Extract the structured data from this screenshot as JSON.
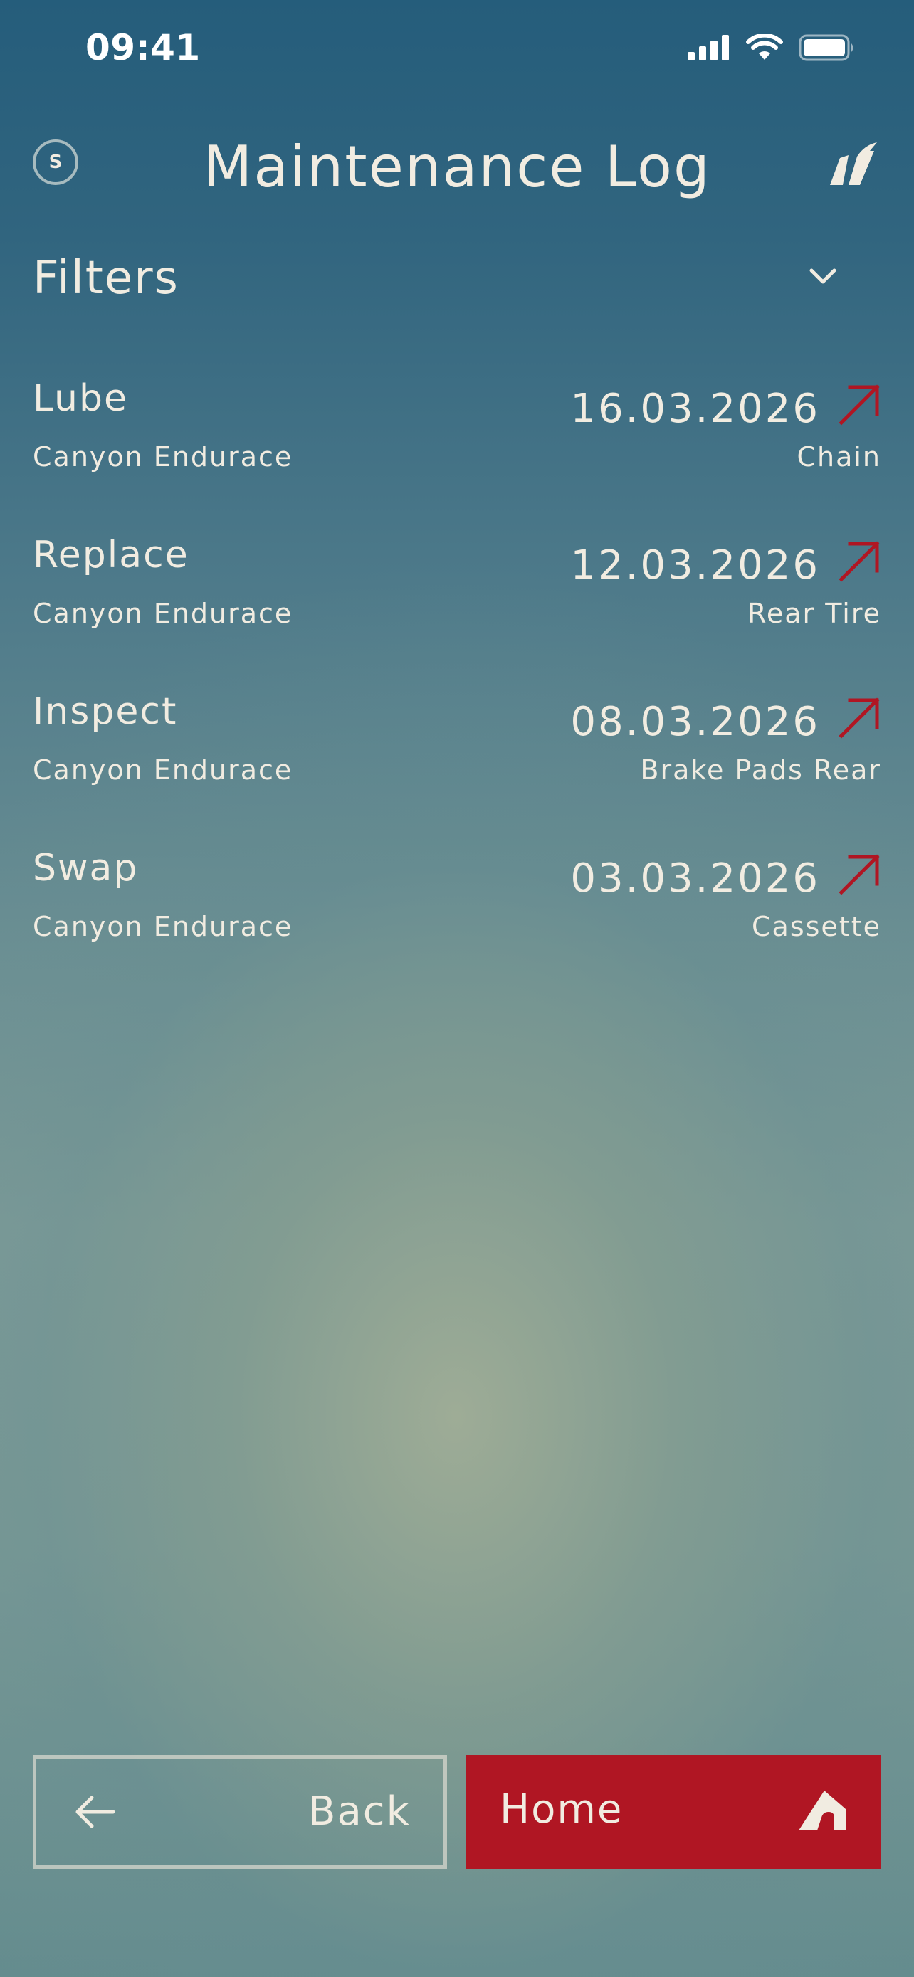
{
  "status_bar": {
    "time": "09:41",
    "icons": [
      "cellular-signal-icon",
      "wifi-icon",
      "battery-icon"
    ]
  },
  "header": {
    "avatar_initial": "S",
    "title": "Maintenance Log",
    "logo_icon": "brand-logo-icon"
  },
  "filters": {
    "label": "Filters",
    "icon": "chevron-down-icon"
  },
  "log": {
    "entries": [
      {
        "action": "Lube",
        "bike": "Canyon Endurace",
        "date": "16.03.2026",
        "component": "Chain"
      },
      {
        "action": "Replace",
        "bike": "Canyon Endurace",
        "date": "12.03.2026",
        "component": "Rear Tire"
      },
      {
        "action": "Inspect",
        "bike": "Canyon Endurace",
        "date": "08.03.2026",
        "component": "Brake Pads Rear"
      },
      {
        "action": "Swap",
        "bike": "Canyon Endurace",
        "date": "03.03.2026",
        "component": "Cassette"
      }
    ]
  },
  "footer": {
    "back_label": "Back",
    "home_label": "Home"
  },
  "colors": {
    "accent": "#b01623",
    "text": "#f1ece1",
    "bg_top": "#255d7b",
    "bg_center": "#9eac96"
  }
}
